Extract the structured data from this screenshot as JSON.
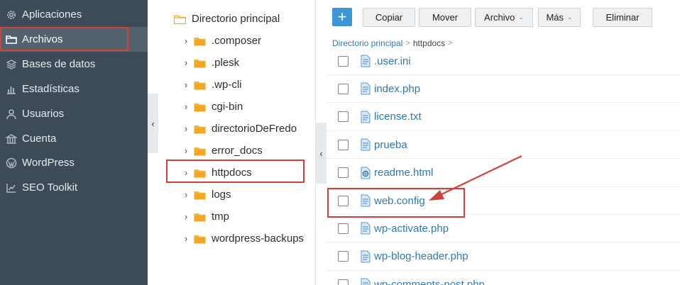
{
  "nav": {
    "items": [
      {
        "label": "Aplicaciones",
        "icon": "gear-icon"
      },
      {
        "label": "Archivos",
        "icon": "folder-icon"
      },
      {
        "label": "Bases de datos",
        "icon": "database-icon"
      },
      {
        "label": "Estadísticas",
        "icon": "bar-chart-icon"
      },
      {
        "label": "Usuarios",
        "icon": "user-icon"
      },
      {
        "label": "Cuenta",
        "icon": "bank-icon"
      },
      {
        "label": "WordPress",
        "icon": "wordpress-icon"
      },
      {
        "label": "SEO Toolkit",
        "icon": "chart-icon"
      }
    ],
    "active": "Archivos"
  },
  "tree": {
    "root": "Directorio principal",
    "folders": [
      ".composer",
      ".plesk",
      ".wp-cli",
      "cgi-bin",
      "directorioDeFredo",
      "error_docs",
      "httpdocs",
      "logs",
      "tmp",
      "wordpress-backups"
    ],
    "selected": "httpdocs"
  },
  "toolbar": {
    "add_label": "+",
    "copy_label": "Copiar",
    "move_label": "Mover",
    "file_label": "Archivo",
    "more_label": "Más",
    "delete_label": "Eliminar"
  },
  "breadcrumb": {
    "root": "Directorio principal",
    "current": "httpdocs",
    "separator": ">"
  },
  "files": [
    {
      "name": ".user.ini",
      "icon": "file-icon"
    },
    {
      "name": "index.php",
      "icon": "file-icon"
    },
    {
      "name": "license.txt",
      "icon": "file-icon"
    },
    {
      "name": "prueba",
      "icon": "file-icon"
    },
    {
      "name": "readme.html",
      "icon": "html-file-icon"
    },
    {
      "name": "web.config",
      "icon": "file-icon"
    },
    {
      "name": "wp-activate.php",
      "icon": "file-icon"
    },
    {
      "name": "wp-blog-header.php",
      "icon": "file-icon"
    },
    {
      "name": "wp-comments-post.php",
      "icon": "file-icon"
    }
  ],
  "colors": {
    "sidebar": "#3d4b59",
    "accent": "#3d96d6",
    "link": "#2e7ab7",
    "folder": "#f5a623",
    "highlight": "#d0433a"
  }
}
